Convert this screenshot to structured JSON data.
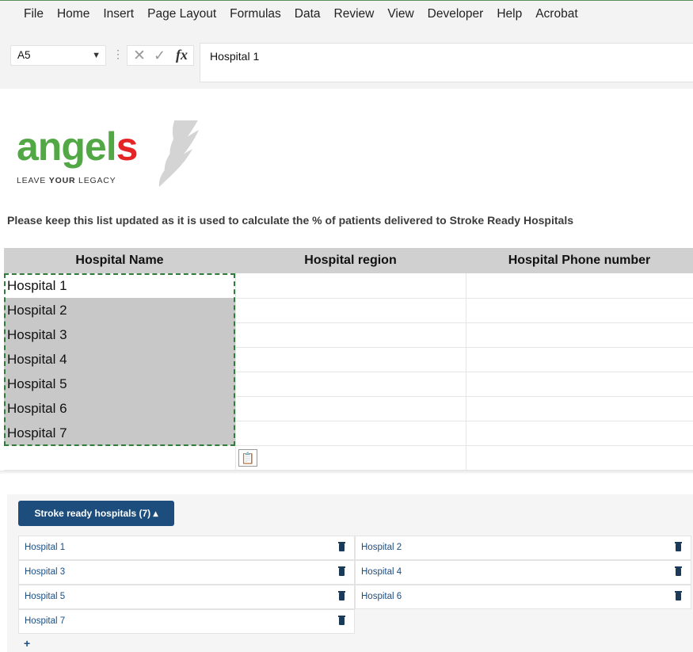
{
  "menu": [
    "File",
    "Home",
    "Insert",
    "Page Layout",
    "Formulas",
    "Data",
    "Review",
    "View",
    "Developer",
    "Help",
    "Acrobat"
  ],
  "formula": {
    "cell_ref": "A5",
    "value": "Hospital 1",
    "cancel_glyph": "✕",
    "enter_glyph": "✓",
    "fx_label": "fx"
  },
  "logo": {
    "word_green": "angel",
    "word_red": "s",
    "tagline_pre": "LEAVE ",
    "tagline_bold": "YOUR",
    "tagline_post": " LEGACY"
  },
  "note": "Please keep this list updated as it is used to calculate the % of patients delivered to Stroke Ready Hospitals",
  "table": {
    "headers": [
      "Hospital Name",
      "Hospital region",
      "Hospital Phone number"
    ],
    "rows": [
      "Hospital 1",
      "Hospital 2",
      "Hospital 3",
      "Hospital 4",
      "Hospital 5",
      "Hospital 6",
      "Hospital 7"
    ]
  },
  "panel": {
    "button_label": "Stroke ready hospitals (7) ▴",
    "items": [
      "Hospital 1",
      "Hospital 2",
      "Hospital 3",
      "Hospital 4",
      "Hospital 5",
      "Hospital 6",
      "Hospital 7"
    ],
    "add_label": "+"
  },
  "icons": {
    "paste_options": "clipboard-icon",
    "delete": "trash-icon"
  },
  "colors": {
    "accent_blue": "#1c4d7c",
    "logo_green": "#53a846",
    "logo_red": "#e52525",
    "selection_green": "#2f7d3a"
  }
}
